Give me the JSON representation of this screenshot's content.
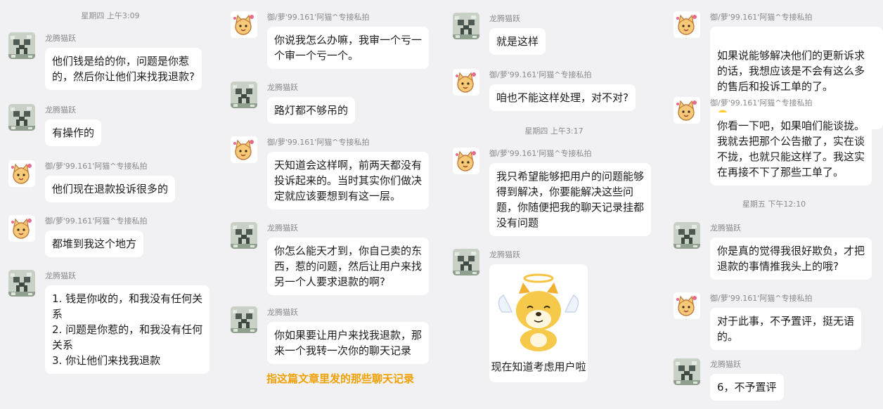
{
  "users": {
    "creeper": {
      "name": "龙腾猫跃"
    },
    "cat": {
      "name": "御/萝'99.161'阿猫^专接私拍"
    }
  },
  "panel1": {
    "timestamp": "星期四 上午3:09",
    "messages": [
      {
        "name": "龙腾猫跃",
        "text": "他们钱是给的你，问题是你惹\n的，然后你让他们来找我退款?"
      },
      {
        "name": "龙腾猫跃",
        "text": "有操作的"
      },
      {
        "name": "御/萝'99.161'阿猫^专接私拍",
        "text": "他们现在退款投诉很多的"
      },
      {
        "name": "御/萝'99.161'阿猫^专接私拍",
        "text": "都堆到我这个地方"
      },
      {
        "name": "龙腾猫跃",
        "text": "1. 钱是你收的，和我没有任何关\n系\n2. 问题是你惹的，和我没有任何\n关系\n3. 你让他们来找我退款"
      }
    ]
  },
  "panel2": {
    "messages": [
      {
        "name": "御/萝'99.161'阿猫^专接私拍",
        "text": "你说我怎么办嘛，我审一个亏一\n个审一个亏一个。"
      },
      {
        "name": "龙腾猫跃",
        "text": "路灯都不够吊的"
      },
      {
        "name": "御/萝'99.161'阿猫^专接私拍",
        "text": "天知道会这样啊，前两天都没有\n投诉起来的。当时其实你们做决\n定就应该要想到有这一层。"
      },
      {
        "name": "龙腾猫跃",
        "text": "你怎么能天才到，你自己卖的东\n西，惹的问题，然后让用户来找\n另一个人要求退款的啊?"
      },
      {
        "name": "龙腾猫跃",
        "text": "你如果要让用户来找我退款，那\n来一个我转一次你的聊天记录"
      }
    ],
    "caption": "指这篇文章里发的那些聊天记录"
  },
  "panel3": {
    "timestamp": "星期四 上午3:17",
    "messages": [
      {
        "name": "龙腾猫跃",
        "text": "就是这样"
      },
      {
        "name": "御/萝'99.161'阿猫^专接私拍",
        "text": "咱也不能这样处理，对不对?"
      },
      {
        "name": "御/萝'99.161'阿猫^专接私拍",
        "text": "我只希望能够把用户的问题能够\n得到解决，你要能解决这些问\n题，你随便把我的聊天记录挂都\n没有问题"
      },
      {
        "name": "龙腾猫跃",
        "sticker_text": "现在知道考虑用户啦"
      }
    ]
  },
  "panel4": {
    "timestamp": "星期五 下午12:10",
    "messages": [
      {
        "name": "御/萝'99.161'阿猫^专接私拍",
        "text": "如果说能够解决他们的更新诉求\n的话，我想应该是不会有这么多\n的售后和投诉工单的了。"
      },
      {
        "name": "御/萝'99.161'阿猫^专接私拍",
        "text": "你看一下吧，如果咱们能谈拢。\n我就去把那个公告撤了，实在谈\n不拢，也就只能这样了。我这实\n在再接不下了那些工单了。"
      },
      {
        "name": "龙腾猫跃",
        "text": "你是真的觉得我很好欺负，才把\n退款的事情推我头上的哦?"
      },
      {
        "name": "御/萝'99.161'阿猫^专接私拍",
        "text": "对于此事，不予置评，挺无语\n的。"
      },
      {
        "name": "龙腾猫跃",
        "text": "6，不予置评"
      }
    ]
  },
  "colors": {
    "background": "#f1f1f3",
    "bubble": "#ffffff",
    "caption": "#f0a000",
    "meta": "#8a8a8e"
  },
  "icons": {
    "creeper": "creeper-avatar-icon",
    "cat": "cat-avatar-icon",
    "emoji": "laughing-emoji-icon",
    "sticker": "angel-dog-sticker"
  }
}
